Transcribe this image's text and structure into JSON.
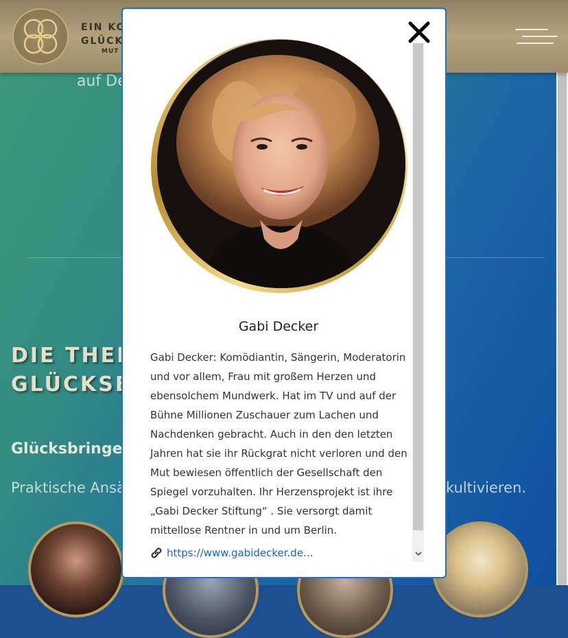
{
  "header": {
    "logo_line1": "EIN KON",
    "logo_line2": "GLÜCKS",
    "logo_line3": "MUT"
  },
  "background": {
    "intro_text": "auf De",
    "heading_line1": "DIE THEME",
    "heading_line2": "GLÜCKSBR",
    "subheading": "Glücksbringer",
    "text_left": "Praktische Ansä",
    "text_right": "kultivieren."
  },
  "modal": {
    "person_name": "Gabi Decker",
    "bio": "Gabi Decker: Komödiantin, Sängerin, Moderatorin und vor allem, Frau mit großem Herzen und ebensolchem Mundwerk. Hat im TV und auf der Bühne Millionen Zuschauer zum Lachen und Nachdenken gebracht. Auch in den den letzten Jahren hat sie ihr Rückgrat nicht verloren und den Mut bewiesen öffentlich der Gesellschaft den Spiegel vorzuhalten. Ihr Herzensprojekt ist ihre „Gabi Decker Stiftung“ . Sie versorgt damit mittellose Rentner in und um Berlin.",
    "link_text": "https://www.gabidecker.de..."
  },
  "colors": {
    "accent_gold": "#c8ad6e",
    "modal_border": "#1f6fd1",
    "link": "#1a66c7"
  },
  "icons": {
    "close": "close-icon",
    "menu": "hamburger-menu-icon",
    "link": "link-icon"
  }
}
